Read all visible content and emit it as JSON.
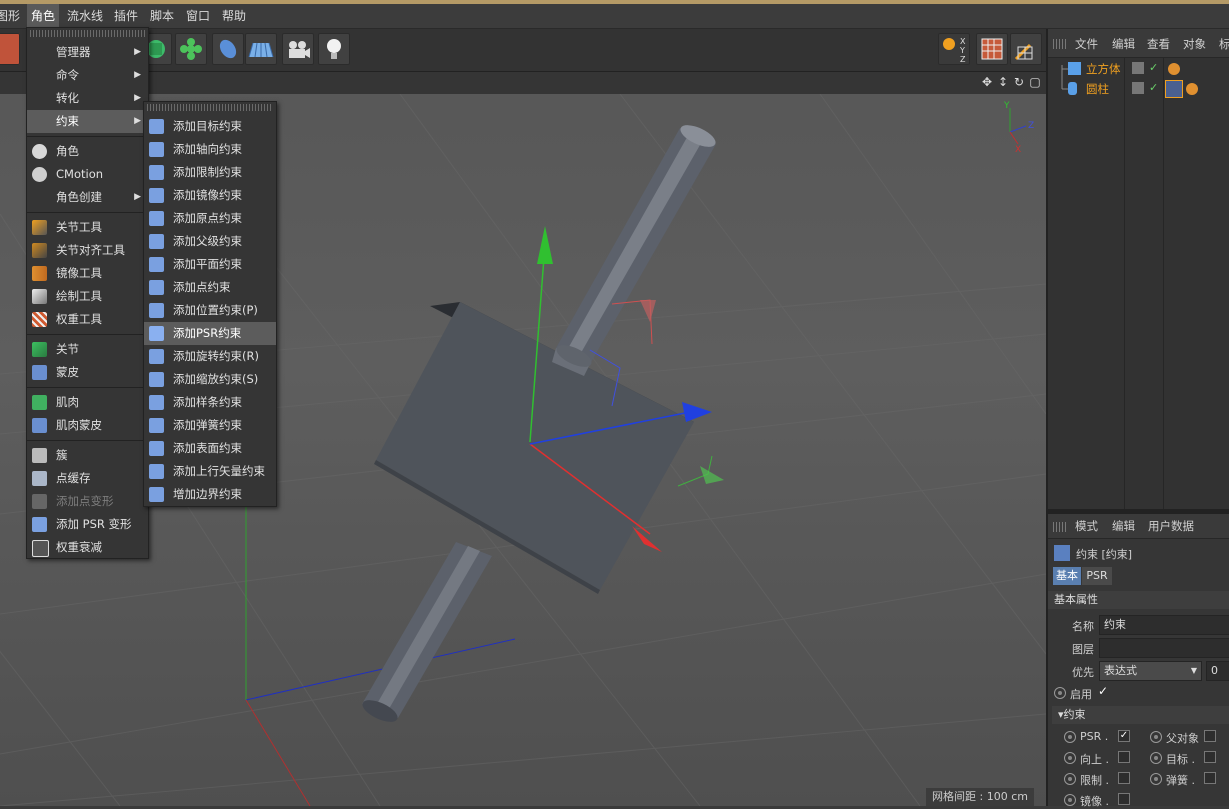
{
  "menubar": {
    "items": [
      "图形",
      "角色",
      "流水线",
      "插件",
      "脚本",
      "窗口",
      "帮助"
    ],
    "active": "角色"
  },
  "character_menu": {
    "items": [
      {
        "label": "管理器",
        "submenu": true
      },
      {
        "label": "命令",
        "submenu": true
      },
      {
        "label": "转化",
        "submenu": true
      },
      {
        "label": "约束",
        "submenu": true,
        "highlighted": true
      },
      {
        "label": "角色",
        "icon": "character-icon"
      },
      {
        "label": "CMotion",
        "icon": "cmotion-icon"
      },
      {
        "label": "角色创建",
        "submenu": true
      },
      {
        "label": "关节工具",
        "icon": "joint-tool-icon"
      },
      {
        "label": "关节对齐工具",
        "icon": "joint-align-icon"
      },
      {
        "label": "镜像工具",
        "icon": "mirror-tool-icon"
      },
      {
        "label": "绘制工具",
        "icon": "paint-tool-icon"
      },
      {
        "label": "权重工具",
        "icon": "weight-tool-icon"
      },
      {
        "label": "关节",
        "icon": "joint-icon"
      },
      {
        "label": "蒙皮",
        "icon": "skin-icon"
      },
      {
        "label": "肌肉",
        "icon": "muscle-icon"
      },
      {
        "label": "肌肉蒙皮",
        "icon": "muscle-skin-icon"
      },
      {
        "label": "簇",
        "icon": "cluster-icon"
      },
      {
        "label": "点缓存",
        "icon": "point-cache-icon"
      },
      {
        "label": "添加点变形",
        "icon": "point-morph-icon",
        "disabled": true
      },
      {
        "label": "添加 PSR 变形",
        "icon": "psr-morph-icon"
      },
      {
        "label": "权重衰减",
        "icon": "weight-falloff-icon"
      }
    ]
  },
  "constraint_submenu": {
    "items": [
      "添加目标约束",
      "添加轴向约束",
      "添加限制约束",
      "添加镜像约束",
      "添加原点约束",
      "添加父级约束",
      "添加平面约束",
      "添加点约束",
      "添加位置约束(P)",
      "添加PSR约束",
      "添加旋转约束(R)",
      "添加缩放约束(S)",
      "添加样条约束",
      "添加弹簧约束",
      "添加表面约束",
      "添加上行矢量约束",
      "增加边界约束"
    ],
    "highlighted_index": 9
  },
  "viewport": {
    "grid_label": "网格间距 : 100 cm",
    "axis_labels": {
      "x": "X",
      "y": "Y",
      "z": "Z"
    }
  },
  "object_manager": {
    "menu": [
      "文件",
      "编辑",
      "查看",
      "对象",
      "标"
    ],
    "objects": [
      {
        "name": "立方体",
        "icon": "cube-icon"
      },
      {
        "name": "圆柱",
        "icon": "cylinder-icon"
      }
    ]
  },
  "attribute_manager": {
    "menu": [
      "模式",
      "编辑",
      "用户数据"
    ],
    "title": "约束 [约束]",
    "tabs": [
      "基本",
      "PSR"
    ],
    "section": "基本属性",
    "fields": {
      "name_label": "名称",
      "name_value": "约束",
      "layer_label": "图层",
      "layer_value": "",
      "priority_label": "优先",
      "priority_value": "表达式",
      "priority_number": "0",
      "enable_label": "启用"
    },
    "group": "约束",
    "constraints": [
      {
        "label": "PSR .",
        "checked": true
      },
      {
        "label": "父对象",
        "checked": false
      },
      {
        "label": "向上 .",
        "checked": false
      },
      {
        "label": "目标 .",
        "checked": false
      },
      {
        "label": "限制 .",
        "checked": false
      },
      {
        "label": "弹簧 .",
        "checked": false
      },
      {
        "label": "镜像 .",
        "checked": false
      }
    ]
  },
  "colors": {
    "accent_orange": "#f0a020",
    "axis_x": "#e03030",
    "axis_y": "#30c030",
    "axis_z": "#2040e0"
  }
}
